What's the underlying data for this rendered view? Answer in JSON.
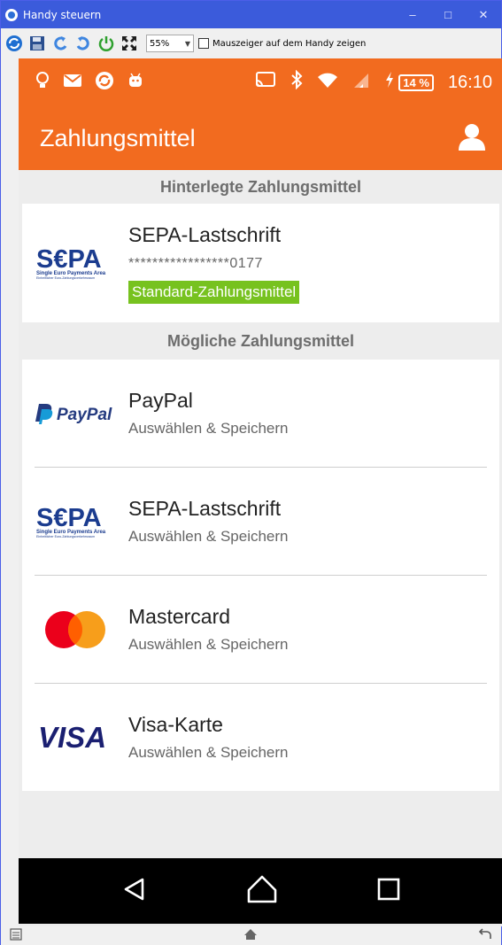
{
  "window": {
    "title": "Handy steuern",
    "controls": [
      "–",
      "□",
      "✕"
    ]
  },
  "toolbar": {
    "zoom": "55%",
    "mouse_checkbox_label": "Mauszeiger auf dem Handy zeigen",
    "mouse_checkbox_checked": false
  },
  "statusbar": {
    "battery": "14 %",
    "time": "16:10"
  },
  "appbar": {
    "title": "Zahlungsmittel"
  },
  "saved": {
    "header": "Hinterlegte Zahlungsmittel",
    "item": {
      "name": "SEPA-Lastschrift",
      "masked": "*****************0177",
      "badge": "Standard-Zahlungsmittel",
      "logo": "sepa-logo"
    }
  },
  "possible": {
    "header": "Mögliche Zahlungsmittel",
    "items": [
      {
        "name": "PayPal",
        "action": "Auswählen & Speichern",
        "logo": "paypal-logo"
      },
      {
        "name": "SEPA-Lastschrift",
        "action": "Auswählen & Speichern",
        "logo": "sepa-logo"
      },
      {
        "name": "Mastercard",
        "action": "Auswählen & Speichern",
        "logo": "mastercard-logo"
      },
      {
        "name": "Visa-Karte",
        "action": "Auswählen & Speichern",
        "logo": "visa-logo"
      }
    ]
  },
  "logos": {
    "sepa_word": "S€PA",
    "sepa_tag": "Single Euro Payments Area",
    "sepa_tag2": "Einheitlicher Euro-Zahlungsverkehrsraum",
    "paypal_word": "PayPal",
    "visa_word": "VISA"
  },
  "colors": {
    "brand_orange": "#f26b1f",
    "badge_green": "#77c21f",
    "window_blue": "#3b5bdb",
    "sepa_blue": "#1b3c8f",
    "sepa_yellow": "#f7c100",
    "paypal_dark": "#253b80",
    "paypal_light": "#179bd7",
    "mc_red": "#eb001b",
    "mc_orange": "#f79e1b",
    "visa_blue": "#1a1f71"
  }
}
